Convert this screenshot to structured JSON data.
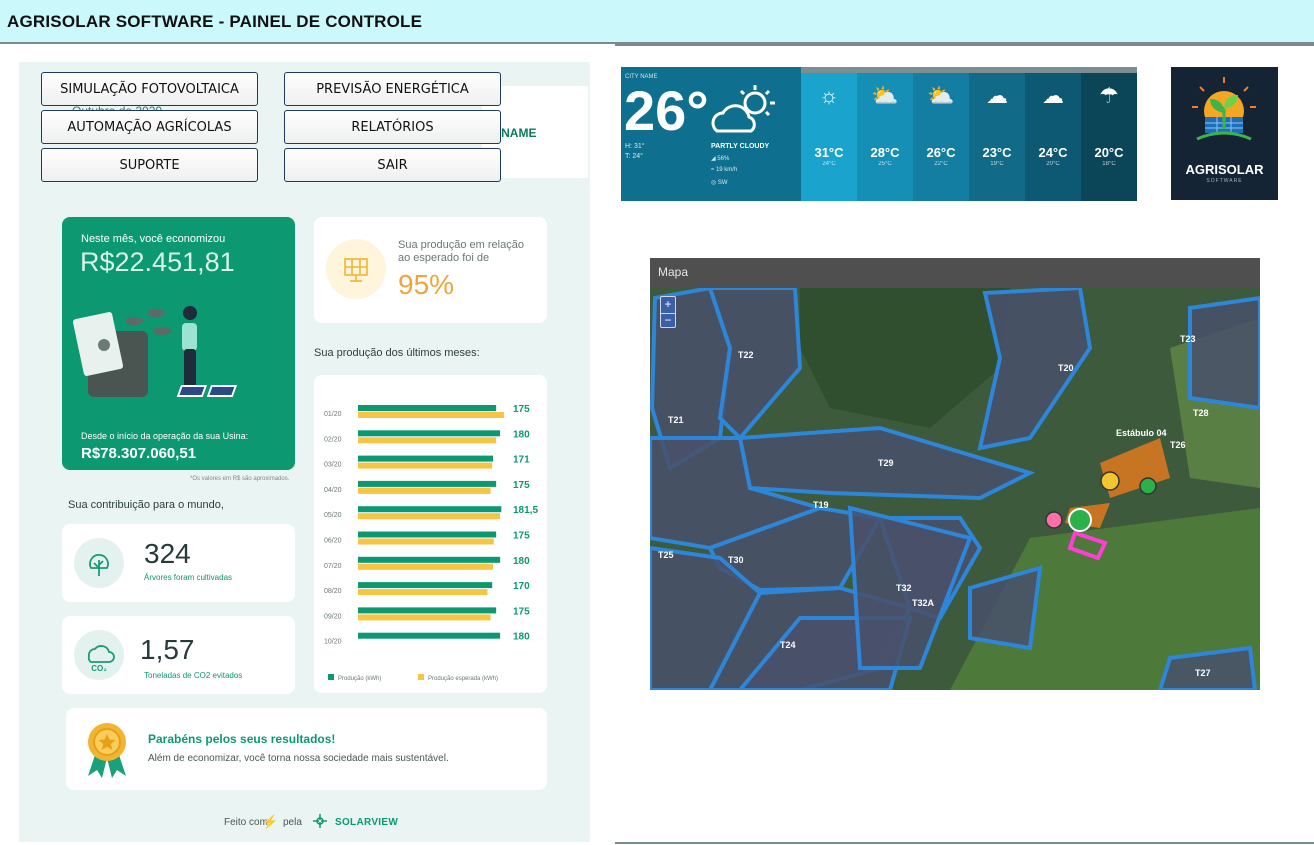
{
  "app": {
    "title": "AGRISOLAR SOFTWARE - PAINEL DE CONTROLE"
  },
  "menu": {
    "simulacao": "SIMULAÇÃO FOTOVOLTAICA",
    "previsao": "PREVISÃO  ENERGÉTICA",
    "automacao": "AUTOMAÇÃO AGRÍCOLAS",
    "relatorios": "RELATÓRIOS",
    "suporte": "SUPORTE",
    "sair": "SAIR"
  },
  "report": {
    "month_partial": "Outubro de 2020",
    "company_partial": "Y NAME",
    "savings_label": "Neste mês, você economizou",
    "savings_value": "R$22.451,81",
    "since_label": "Desde o início da operação da sua Usina:",
    "since_value": "R$78.307.060,51",
    "approx_note": "*Os valores em R$ são aproximados.",
    "production_label": "Sua produção em relação ao esperado foi de",
    "production_pct": "95%",
    "months_label": "Sua produção dos últimos meses:",
    "contribution_label": "Sua contribuição para o mundo,",
    "trees_value": "324",
    "trees_label": "Árvores foram cultivadas",
    "co2_value": "1,57",
    "co2_label": "Toneladas de CO2 evitados",
    "co2_icon_text": "CO₂",
    "congrats_title": "Parabéns pelos seus resultados!",
    "congrats_text": "Além de economizar, você torna nossa sociedade mais sustentável.",
    "footer_made": "Feito com",
    "footer_by": "pela",
    "footer_brand": "SOLARVIEW"
  },
  "chart_data": {
    "type": "bar",
    "categories": [
      "01/20",
      "02/20",
      "03/20",
      "04/20",
      "05/20",
      "06/20",
      "07/20",
      "08/20",
      "09/20",
      "10/20"
    ],
    "series": [
      {
        "name": "Produção (kWh)",
        "values": [
          175,
          180,
          171,
          175,
          181.5,
          175,
          180,
          170,
          175,
          180
        ],
        "color": "#0c9871"
      },
      {
        "name": "Produção esperada (kWh)",
        "values": [
          185,
          175,
          170,
          168,
          180,
          172,
          171,
          164,
          168,
          null
        ],
        "color": "#f7c544"
      }
    ],
    "value_labels": [
      "175",
      "180",
      "171",
      "175",
      "181,5",
      "175",
      "180",
      "170",
      "175",
      "180"
    ],
    "legend_position": "bottom"
  },
  "weather": {
    "city_label": "CITY NAME",
    "current_temp": "26°",
    "high": "H: 31°",
    "low": "T: 24°",
    "condition": "PARTLY CLOUDY",
    "humidity": "56%",
    "wind": "19 km/h",
    "direction": "SW",
    "forecast": [
      {
        "temp": "31°C",
        "low": "24°C",
        "icon": "sun-icon"
      },
      {
        "temp": "28°C",
        "low": "25°C",
        "icon": "partly-cloudy-icon"
      },
      {
        "temp": "26°C",
        "low": "22°C",
        "icon": "partly-cloudy-icon"
      },
      {
        "temp": "23°C",
        "low": "19°C",
        "icon": "cloud-icon"
      },
      {
        "temp": "24°C",
        "low": "20°C",
        "icon": "clouds-icon"
      },
      {
        "temp": "20°C",
        "low": "18°C",
        "icon": "rain-icon"
      }
    ]
  },
  "logo": {
    "name": "AGRISOLAR",
    "sub": "SOFTWARE"
  },
  "map": {
    "title": "Mapa",
    "zoom_in": "+",
    "zoom_out": "−",
    "labels": [
      "T22",
      "T20",
      "T23",
      "T21",
      "T29",
      "T19",
      "T25",
      "T30",
      "T32",
      "T32A",
      "T24",
      "T27",
      "T28",
      "Estábulo 04",
      "T26"
    ]
  }
}
